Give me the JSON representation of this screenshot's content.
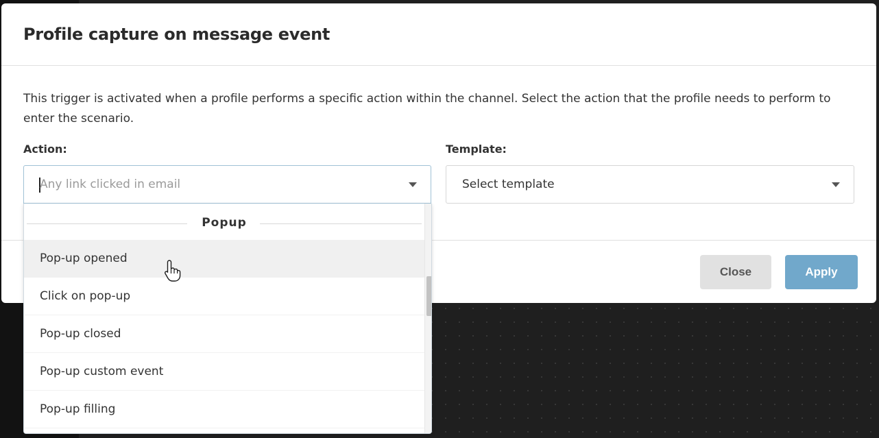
{
  "modal": {
    "title": "Profile capture on message event",
    "description": "This trigger is activated when a profile performs a specific action within the channel. Select the action that the profile needs to perform to enter the scenario."
  },
  "action": {
    "label": "Action:",
    "placeholder": "Any link clicked in email"
  },
  "template": {
    "label": "Template:",
    "value": "Select template"
  },
  "dropdown": {
    "group": "Popup",
    "options": [
      {
        "label": "Pop-up opened",
        "hovered": true
      },
      {
        "label": "Click on pop-up"
      },
      {
        "label": "Pop-up closed"
      },
      {
        "label": "Pop-up custom event"
      },
      {
        "label": "Pop-up filling"
      }
    ]
  },
  "footer": {
    "close_label": "Close",
    "apply_label": "Apply"
  },
  "colors": {
    "apply_bg": "#71a8cb",
    "close_bg": "#e1e1e1",
    "focus_border": "#9fc1d6",
    "overlay_bg": "#1f1f1f"
  },
  "icons": {
    "dropdown_chevron": "chevron-down-icon",
    "pointer": "hand-pointer-cursor-icon"
  }
}
